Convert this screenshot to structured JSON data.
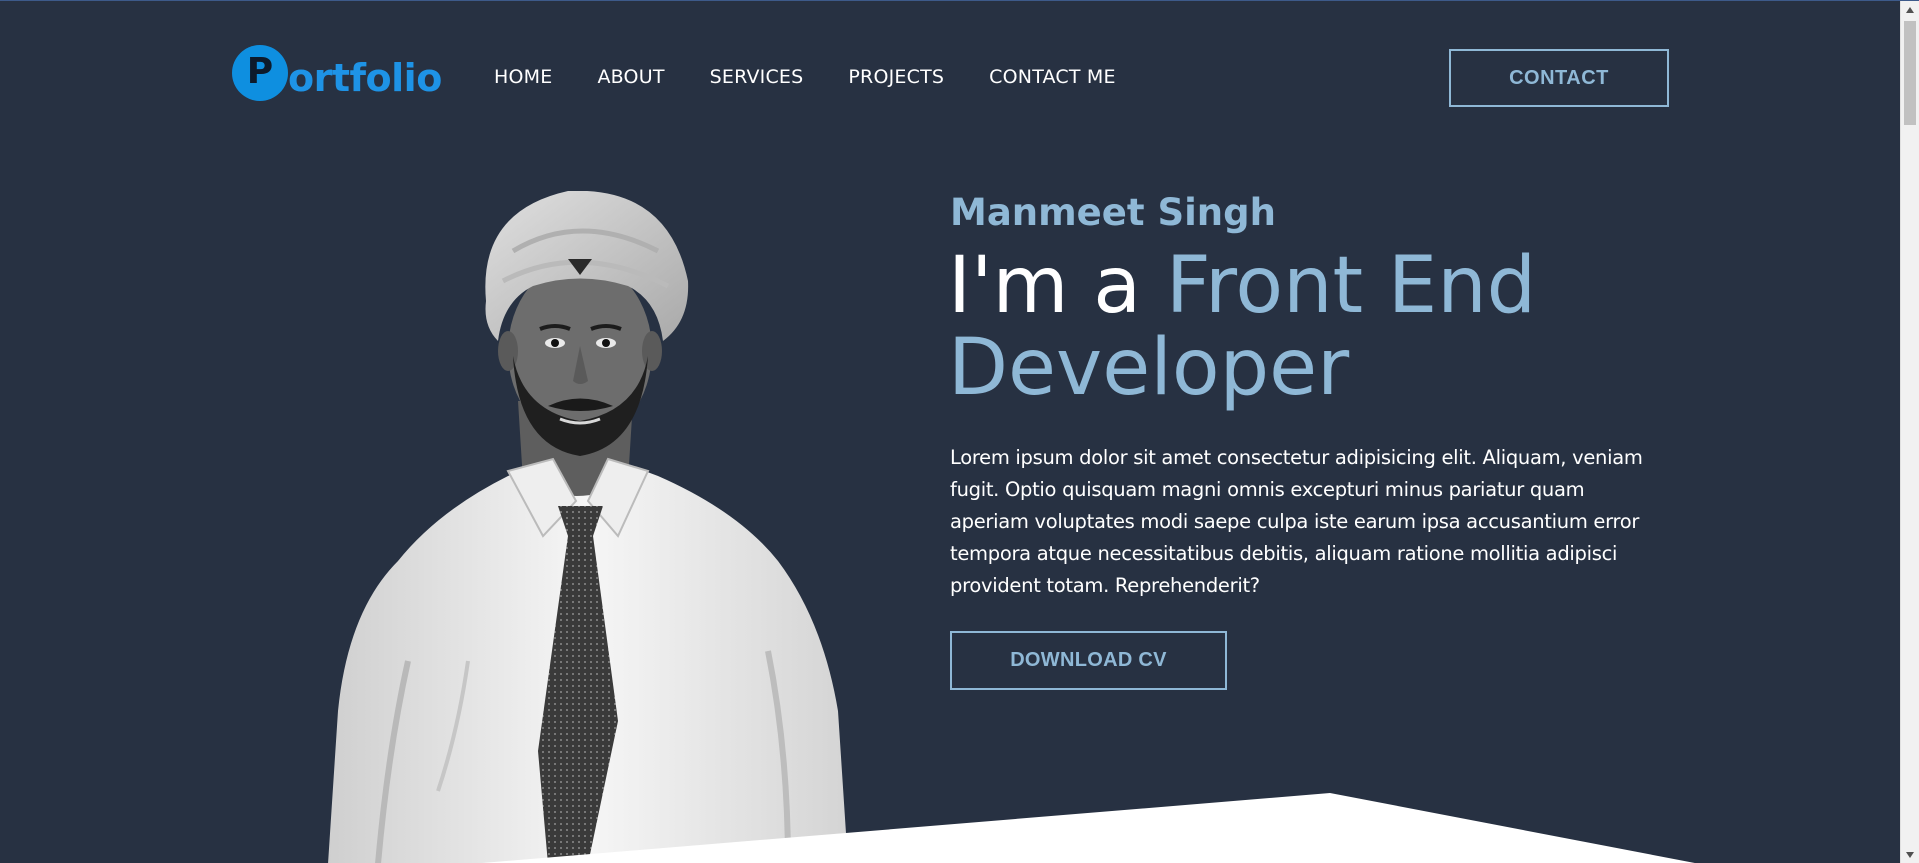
{
  "header": {
    "logo_initial": "P",
    "logo_rest": "ortfolio",
    "nav": [
      "HOME",
      "ABOUT",
      "SERVICES",
      "PROJECTS",
      "CONTACT ME"
    ],
    "contact_label": "CONTACT"
  },
  "hero": {
    "name": "Manmeet Singh",
    "title_prefix": "I'm a ",
    "title_accent": "Front End Developer",
    "description": "Lorem ipsum dolor sit amet consectetur adipisicing elit. Aliquam, veniam fugit. Optio quisquam magni omnis excepturi minus pariatur quam aperiam voluptates modi saepe culpa iste earum ipsa accusantium error tempora atque necessitatibus debitis, aliquam ratione mollitia adipisci provident totam. Reprehenderit?",
    "cv_label": "DOWNLOAD CV"
  },
  "colors": {
    "background": "#273142",
    "accent": "#8fb8d6",
    "logo_blue": "#1e93e6"
  },
  "icons": {
    "scroll_up": "triangle-up-icon",
    "scroll_down": "triangle-down-icon"
  }
}
